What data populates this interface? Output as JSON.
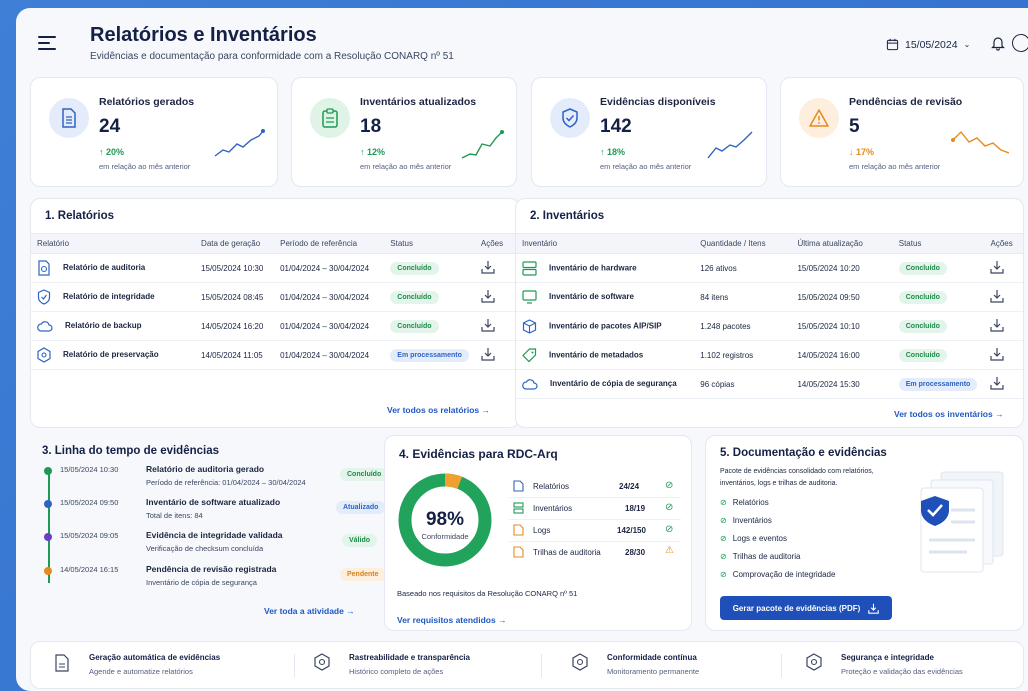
{
  "header": {
    "title": "Relatórios e Inventários",
    "subtitle": "Evidências e documentação para conformidade com a Resolução CONARQ nº 51",
    "date": "15/05/2024"
  },
  "kpis": [
    {
      "label": "Relatórios gerados",
      "value": "24",
      "delta": "↑ 20%",
      "compare": "em relação ao mês anterior",
      "color": "#2e63c4",
      "trend": "up"
    },
    {
      "label": "Inventários atualizados",
      "value": "18",
      "delta": "↑ 12%",
      "compare": "em relação ao mês anterior",
      "color": "#1e9a55",
      "trend": "up"
    },
    {
      "label": "Evidências disponíveis",
      "value": "142",
      "delta": "↑ 18%",
      "compare": "em relação ao mês anterior",
      "color": "#2e63c4",
      "trend": "up"
    },
    {
      "label": "Pendências de revisão",
      "value": "5",
      "delta": "↓ 17%",
      "compare": "em relação ao mês anterior",
      "color": "#e58a1f",
      "trend": "down"
    }
  ],
  "reports": {
    "title": "1. Relatórios",
    "columns": [
      "Relatório",
      "Data de geração",
      "Período de referência",
      "Status",
      "Ações"
    ],
    "rows": [
      {
        "name": "Relatório de auditoria",
        "date": "15/05/2024 10:30",
        "period": "01/04/2024 – 30/04/2024",
        "status": "Concluído"
      },
      {
        "name": "Relatório de integridade",
        "date": "15/05/2024 08:45",
        "period": "01/04/2024 – 30/04/2024",
        "status": "Concluído"
      },
      {
        "name": "Relatório de backup",
        "date": "14/05/2024 16:20",
        "period": "01/04/2024 – 30/04/2024",
        "status": "Concluído"
      },
      {
        "name": "Relatório de preservação",
        "date": "14/05/2024 11:05",
        "period": "01/04/2024 – 30/04/2024",
        "status": "Em processamento"
      }
    ],
    "link": "Ver todos os relatórios  →"
  },
  "inventories": {
    "title": "2. Inventários",
    "columns": [
      "Inventário",
      "Quantidade / Itens",
      "Última atualização",
      "Status",
      "Ações"
    ],
    "rows": [
      {
        "name": "Inventário de hardware",
        "qty": "126 ativos",
        "date": "15/05/2024 10:20",
        "status": "Concluído"
      },
      {
        "name": "Inventário de software",
        "qty": "84 itens",
        "date": "15/05/2024 09:50",
        "status": "Concluído"
      },
      {
        "name": "Inventário de pacotes AIP/SIP",
        "qty": "1.248 pacotes",
        "date": "15/05/2024 10:10",
        "status": "Concluído"
      },
      {
        "name": "Inventário de metadados",
        "qty": "1.102 registros",
        "date": "14/05/2024 16:00",
        "status": "Concluído"
      },
      {
        "name": "Inventário de cópia de segurança",
        "qty": "96 cópias",
        "date": "14/05/2024 15:30",
        "status": "Em processamento"
      }
    ],
    "link": "Ver todos os inventários  →"
  },
  "timeline": {
    "title": "3. Linha do tempo de evidências",
    "items": [
      {
        "time": "15/05/2024 10:30",
        "title": "Relatório de auditoria gerado",
        "detail": "Período de referência: 01/04/2024 – 30/04/2024",
        "badge": "Concluído",
        "color": "#1e9a55"
      },
      {
        "time": "15/05/2024 09:50",
        "title": "Inventário de software atualizado",
        "detail": "Total de itens: 84",
        "badge": "Atualizado",
        "color": "#2e63c4"
      },
      {
        "time": "15/05/2024 09:05",
        "title": "Evidência de integridade validada",
        "detail": "Verificação de checksum concluída",
        "badge": "Válido",
        "color": "#6a3fc4"
      },
      {
        "time": "14/05/2024 16:15",
        "title": "Pendência de revisão registrada",
        "detail": "Inventário de cópia de segurança",
        "badge": "Pendente",
        "color": "#e58a1f"
      }
    ],
    "link": "Ver toda a atividade  →"
  },
  "rdc": {
    "title": "4. Evidências para RDC-Arq",
    "percent": "98%",
    "percent_label": "Conformidade",
    "fraction": 0.98,
    "items": [
      {
        "label": "Relatórios",
        "value": "24/24",
        "ok": true
      },
      {
        "label": "Inventários",
        "value": "18/19",
        "ok": true
      },
      {
        "label": "Logs",
        "value": "142/150",
        "ok": true
      },
      {
        "label": "Trilhas de auditoria",
        "value": "28/30",
        "ok": false
      }
    ],
    "note": "Baseado nos requisitos da Resolução CONARQ nº 51",
    "link": "Ver requisitos atendidos  →"
  },
  "docs": {
    "title": "5. Documentação e evidências",
    "desc1": "Pacote de evidências consolidado com relatórios,",
    "desc2": "inventários, logs e trilhas de auditoria.",
    "items": [
      "Relatórios",
      "Inventários",
      "Logs e eventos",
      "Trilhas de auditoria",
      "Comprovação de integridade"
    ],
    "button": "Gerar pacote de evidências (PDF)"
  },
  "footer": [
    {
      "title": "Geração automática de evidências",
      "sub": "Agende e automatize relatórios"
    },
    {
      "title": "Rastreabilidade e transparência",
      "sub": "Histórico completo de ações"
    },
    {
      "title": "Conformidade contínua",
      "sub": "Monitoramento permanente"
    },
    {
      "title": "Segurança e integridade",
      "sub": "Proteção e validação das evidências"
    }
  ]
}
